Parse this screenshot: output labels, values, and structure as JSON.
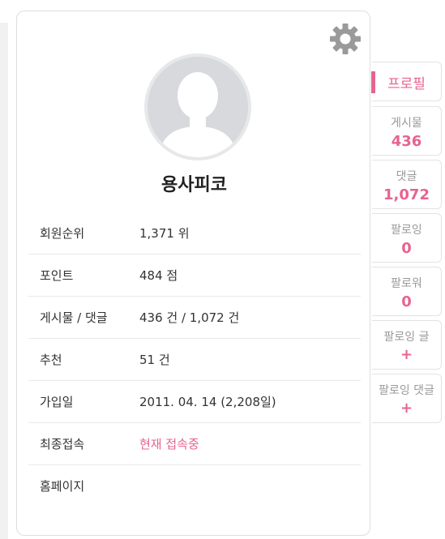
{
  "profile": {
    "nickname": "용사피코",
    "gear_icon": "gear-icon",
    "avatar_icon": "default-user-avatar-icon"
  },
  "info_rows": [
    {
      "label": "회원순위",
      "value": "1,371 위"
    },
    {
      "label": "포인트",
      "value": "484 점"
    },
    {
      "label": "게시물 / 댓글",
      "value": "436 건 / 1,072 건"
    },
    {
      "label": "추천",
      "value": "51 건"
    },
    {
      "label": "가입일",
      "value": "2011. 04. 14 (2,208일)"
    },
    {
      "label": "최종접속",
      "value": "현재 접속중"
    },
    {
      "label": "홈페이지",
      "value": ""
    }
  ],
  "side_tabs": {
    "profile": {
      "label": "프로필"
    },
    "posts": {
      "label": "게시물",
      "count": "436"
    },
    "comments": {
      "label": "댓글",
      "count": "1,072"
    },
    "following": {
      "label": "팔로잉",
      "count": "0"
    },
    "followers": {
      "label": "팔로워",
      "count": "0"
    },
    "following_posts": {
      "label": "팔로잉 글",
      "action": "+"
    },
    "following_comments": {
      "label": "팔로잉 댓글",
      "action": "+"
    }
  },
  "colors": {
    "accent": "#e8638f",
    "border": "#e3e3e3",
    "gear": "#9a9a9a",
    "avatar_bg": "#d7d9dc"
  }
}
